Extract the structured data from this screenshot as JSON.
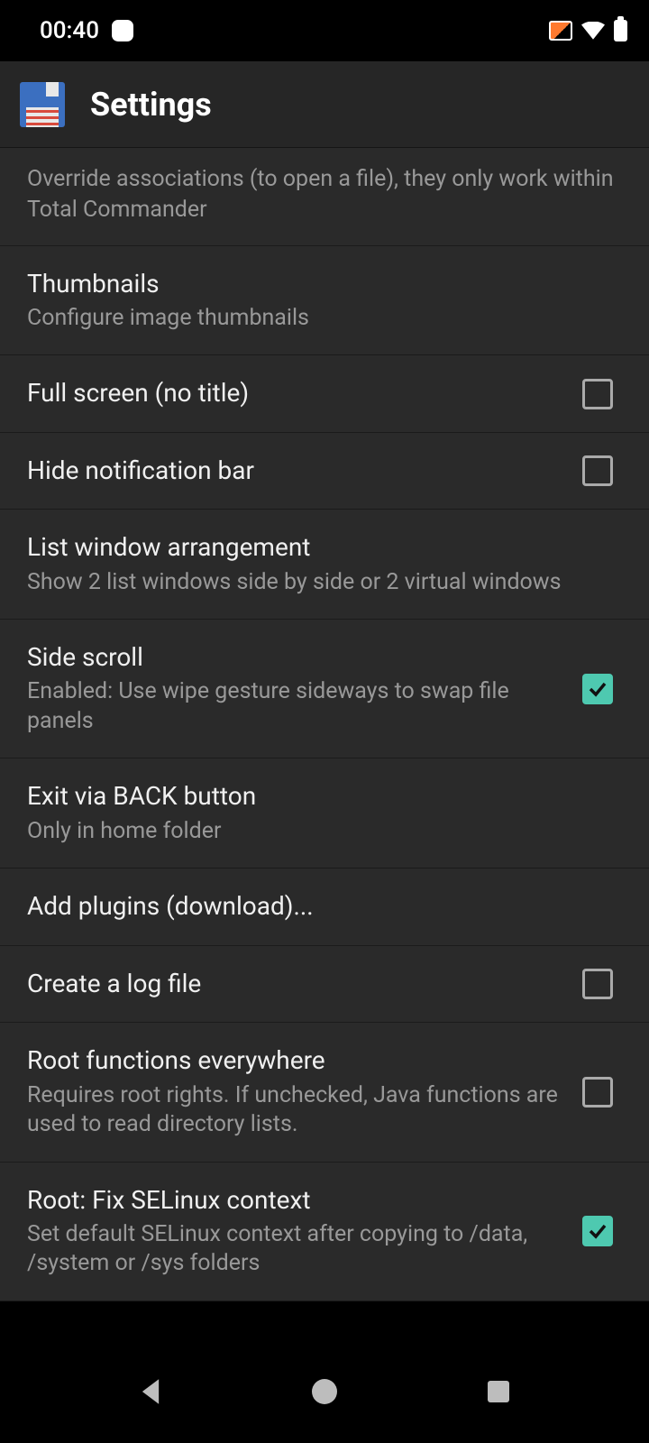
{
  "status": {
    "time": "00:40"
  },
  "header": {
    "title": "Settings"
  },
  "items": {
    "associations_desc": "Override associations (to open a file), they only work within Total Commander",
    "thumbnails": {
      "title": "Thumbnails",
      "desc": "Configure image thumbnails"
    },
    "fullscreen": {
      "title": "Full screen (no title)",
      "checked": false
    },
    "hide_notif": {
      "title": "Hide notification bar",
      "checked": false
    },
    "list_window": {
      "title": "List window arrangement",
      "desc": "Show 2 list windows side by side or 2 virtual windows"
    },
    "side_scroll": {
      "title": "Side scroll",
      "desc": "Enabled: Use wipe gesture sideways to swap file panels",
      "checked": true
    },
    "exit_back": {
      "title": "Exit via BACK button",
      "desc": "Only in home folder"
    },
    "add_plugins": {
      "title": "Add plugins (download)..."
    },
    "log_file": {
      "title": "Create a log file",
      "checked": false
    },
    "root_everywhere": {
      "title": "Root functions everywhere",
      "desc": "Requires root rights. If unchecked, Java functions are used to read directory lists.",
      "checked": false
    },
    "root_selinux": {
      "title": "Root: Fix SELinux context",
      "desc": "Set default SELinux context after copying to /data, /system or /sys folders",
      "checked": true
    }
  }
}
